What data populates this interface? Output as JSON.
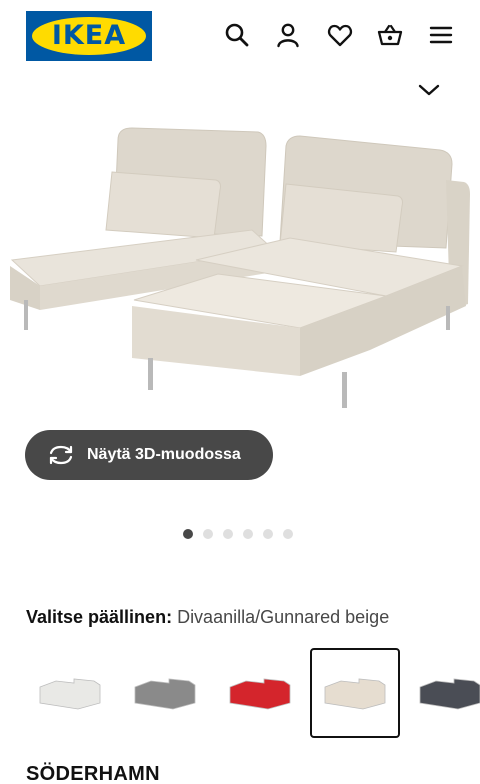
{
  "header": {
    "logo_text": "IKEA",
    "brand_colors": {
      "blue": "#0058a3",
      "yellow": "#ffdb00"
    },
    "icons": [
      "search-icon",
      "user-icon",
      "heart-icon",
      "cart-icon",
      "menu-icon"
    ]
  },
  "hero": {
    "expand_icon": "chevron-down-icon",
    "view_3d_label": "Näytä 3D-muodossa",
    "view_3d_icon": "rotate-icon",
    "carousel": {
      "count": 6,
      "active": 1
    }
  },
  "cover": {
    "label": "Valitse päällinen:",
    "value": " Divaanilla/Gunnared beige",
    "options": [
      {
        "color": "#e9e9e6",
        "selected": false
      },
      {
        "color": "#8a8a8a",
        "selected": false
      },
      {
        "color": "#d4252c",
        "selected": false
      },
      {
        "color": "#e6ddd0",
        "selected": true
      },
      {
        "color": "#4a4d55",
        "selected": false
      }
    ]
  },
  "product": {
    "name": "SÖDERHAMN"
  }
}
